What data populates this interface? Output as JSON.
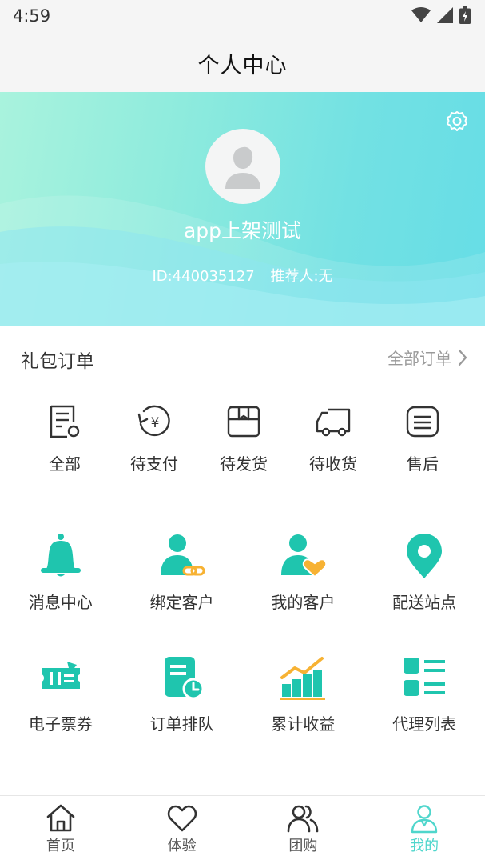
{
  "status_bar": {
    "time": "4:59"
  },
  "header": {
    "title": "个人中心"
  },
  "profile": {
    "username": "app上架测试",
    "id_text": "ID:440035127",
    "referrer_text": "推荐人:无"
  },
  "orders": {
    "title": "礼包订单",
    "all_label": "全部订单",
    "items": [
      {
        "label": "全部",
        "icon": "document-icon"
      },
      {
        "label": "待支付",
        "icon": "yen-clock-icon"
      },
      {
        "label": "待发货",
        "icon": "box-icon"
      },
      {
        "label": "待收货",
        "icon": "truck-icon"
      },
      {
        "label": "售后",
        "icon": "list-card-icon"
      }
    ]
  },
  "grid": {
    "items": [
      {
        "label": "消息中心",
        "icon": "bell-icon"
      },
      {
        "label": "绑定客户",
        "icon": "user-link-icon"
      },
      {
        "label": "我的客户",
        "icon": "user-heart-icon"
      },
      {
        "label": "配送站点",
        "icon": "location-pin-icon"
      },
      {
        "label": "电子票券",
        "icon": "ticket-icon"
      },
      {
        "label": "订单排队",
        "icon": "order-clock-icon"
      },
      {
        "label": "累计收益",
        "icon": "bar-growth-icon"
      },
      {
        "label": "代理列表",
        "icon": "agent-list-icon"
      }
    ]
  },
  "tabs": [
    {
      "label": "首页",
      "icon": "home-icon"
    },
    {
      "label": "体验",
      "icon": "heart-icon"
    },
    {
      "label": "团购",
      "icon": "group-icon"
    },
    {
      "label": "我的",
      "icon": "profile-icon",
      "active": true
    }
  ],
  "colors": {
    "accent": "#1fc5ae",
    "active_tab": "#4fd6cc",
    "coin": "#f7b233"
  }
}
